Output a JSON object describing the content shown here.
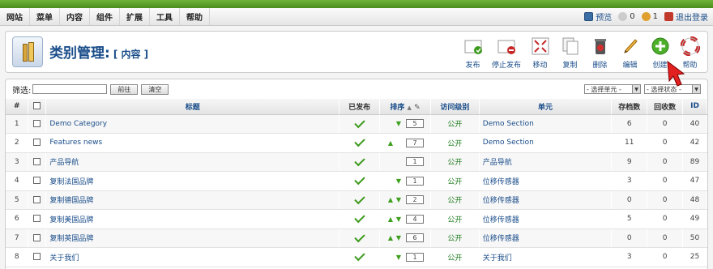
{
  "menu": [
    "网站",
    "菜单",
    "内容",
    "组件",
    "扩展",
    "工具",
    "帮助"
  ],
  "status": {
    "preview": "预览",
    "messages": "0",
    "users": "1",
    "logout": "退出登录"
  },
  "header": {
    "title": "类别管理:",
    "subtitle": "[ 内容 ]"
  },
  "toolbar": {
    "publish": "发布",
    "unpublish": "停止发布",
    "move": "移动",
    "copy": "复制",
    "delete": "删除",
    "edit": "编辑",
    "new": "创建",
    "help": "帮助"
  },
  "filter": {
    "label": "筛选:",
    "input_value": "",
    "go": "前往",
    "reset": "清空",
    "select_section": "- 选择单元 -",
    "select_state": "- 选择状态 -"
  },
  "table": {
    "columns": {
      "num": "#",
      "title": "标题",
      "published": "已发布",
      "order": "排序",
      "access": "访问级别",
      "section": "单元",
      "archived": "存档数",
      "trashed": "回收数",
      "id": "ID"
    },
    "rows": [
      {
        "num": "1",
        "title": "Demo Category",
        "up": false,
        "down": true,
        "order": "5",
        "access": "公开",
        "section": "Demo Section",
        "archived": "6",
        "trashed": "0",
        "id": "40"
      },
      {
        "num": "2",
        "title": "Features news",
        "up": true,
        "down": false,
        "order": "7",
        "access": "公开",
        "section": "Demo Section",
        "archived": "11",
        "trashed": "0",
        "id": "42"
      },
      {
        "num": "3",
        "title": "产品导航",
        "up": false,
        "down": false,
        "order": "1",
        "access": "公开",
        "section": "产品导航",
        "archived": "9",
        "trashed": "0",
        "id": "89"
      },
      {
        "num": "4",
        "title": "复制法国品牌",
        "up": false,
        "down": true,
        "order": "1",
        "access": "公开",
        "section": "位移传感器",
        "archived": "3",
        "trashed": "0",
        "id": "47"
      },
      {
        "num": "5",
        "title": "复制德国品牌",
        "up": true,
        "down": true,
        "order": "2",
        "access": "公开",
        "section": "位移传感器",
        "archived": "0",
        "trashed": "0",
        "id": "48"
      },
      {
        "num": "6",
        "title": "复制美国品牌",
        "up": true,
        "down": true,
        "order": "4",
        "access": "公开",
        "section": "位移传感器",
        "archived": "5",
        "trashed": "0",
        "id": "49"
      },
      {
        "num": "7",
        "title": "复制英国品牌",
        "up": true,
        "down": true,
        "order": "6",
        "access": "公开",
        "section": "位移传感器",
        "archived": "0",
        "trashed": "0",
        "id": "50"
      },
      {
        "num": "8",
        "title": "关于我们",
        "up": false,
        "down": true,
        "order": "1",
        "access": "公开",
        "section": "关于我们",
        "archived": "3",
        "trashed": "0",
        "id": "25"
      }
    ]
  },
  "colors": {
    "accent": "#1a4d8a",
    "topbar": "#5ca22a",
    "check": "#3c9a1c"
  }
}
